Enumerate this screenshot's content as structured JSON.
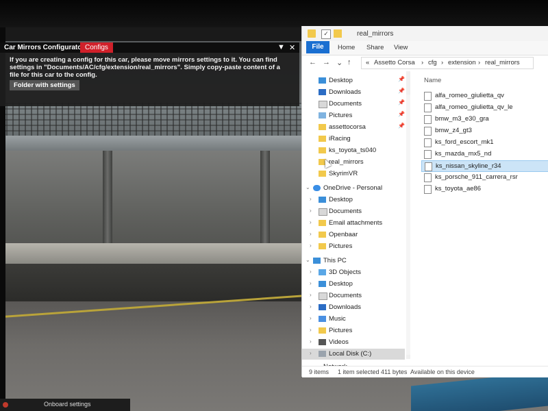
{
  "configurator": {
    "title": "Car Mirrors Configurator",
    "tab": "Configs",
    "dropdown_glyph": "▼",
    "close_glyph": "✕",
    "message": "If you are creating a config for this car, please move mirrors settings to it. You can find settings in \"Documents/AC/cfg/extension/real_mirrors\". Simply copy-paste content of a file for this car to the config.",
    "button": "Folder with settings"
  },
  "game": {
    "taskbar_label": "Onboard settings"
  },
  "explorer": {
    "title": "real_mirrors",
    "ribbon": {
      "file": "File",
      "tabs": [
        "Home",
        "Share",
        "View"
      ]
    },
    "nav_glyphs": {
      "back": "←",
      "forward": "→",
      "down": "⌄",
      "up": "↑"
    },
    "breadcrumb": [
      "«",
      "Assetto Corsa",
      "›",
      "cfg",
      "›",
      "extension",
      "›",
      "real_mirrors"
    ],
    "column_header": "Name",
    "nav": {
      "quick_access": [
        {
          "label": "Desktop",
          "icon": "desktop-icon",
          "pinned": true
        },
        {
          "label": "Downloads",
          "icon": "download-icon",
          "pinned": true
        },
        {
          "label": "Documents",
          "icon": "documents-icon",
          "pinned": true
        },
        {
          "label": "Pictures",
          "icon": "pictures-icon",
          "pinned": true
        },
        {
          "label": "assettocorsa",
          "icon": "folder-icon",
          "pinned": true
        },
        {
          "label": "iRacing",
          "icon": "folder-icon",
          "pinned": false
        },
        {
          "label": "ks_toyota_ts040",
          "icon": "folder-icon",
          "pinned": false
        },
        {
          "label": "real_mirrors",
          "icon": "folder-icon",
          "pinned": false
        },
        {
          "label": "SkyrimVR",
          "icon": "folder-icon",
          "pinned": false
        }
      ],
      "onedrive": {
        "label": "OneDrive - Personal",
        "items": [
          "Desktop",
          "Documents",
          "Email attachments",
          "Openbaar",
          "Pictures"
        ]
      },
      "this_pc": {
        "label": "This PC",
        "items": [
          "3D Objects",
          "Desktop",
          "Documents",
          "Downloads",
          "Music",
          "Pictures",
          "Videos",
          "Local Disk (C:)"
        ],
        "selected": "Local Disk (C:)"
      },
      "network": "Network"
    },
    "files": [
      "alfa_romeo_giulietta_qv",
      "alfa_romeo_giulietta_qv_le",
      "bmw_m3_e30_gra",
      "bmw_z4_gt3",
      "ks_ford_escort_mk1",
      "ks_mazda_mx5_nd",
      "ks_nissan_skyline_r34",
      "ks_porsche_911_carrera_rsr",
      "ks_toyota_ae86"
    ],
    "selected_file": "ks_nissan_skyline_r34",
    "status": {
      "count": "9 items",
      "selection": "1 item selected  411 bytes",
      "availability": "Available on this device"
    },
    "colors": {
      "accent": "#1a6fd1",
      "selection": "#cce4f7",
      "folder": "#f2c94c"
    }
  }
}
